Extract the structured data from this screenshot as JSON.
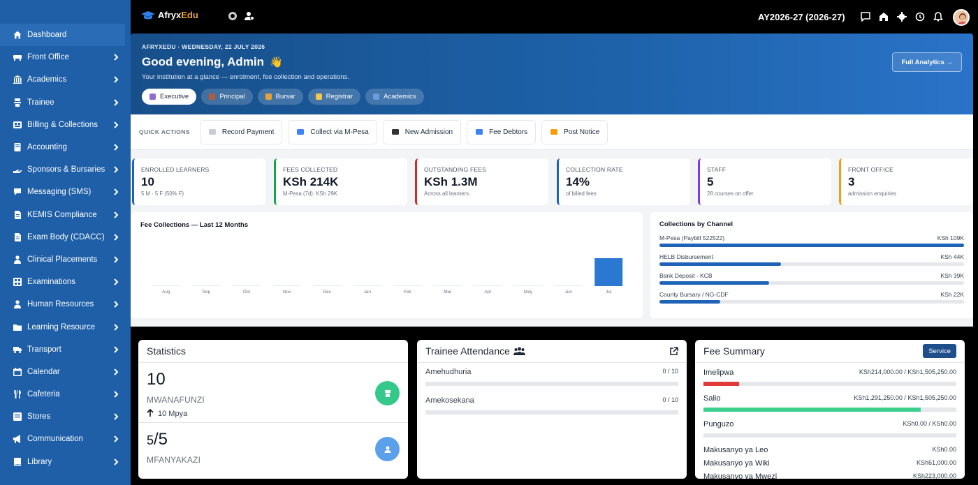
{
  "brand": {
    "name_prefix": "Afryx",
    "name_suffix": "Edu"
  },
  "topbar": {
    "academic_year": "AY2026-27 (2026-27)"
  },
  "sidebar": {
    "items": [
      {
        "label": "Dashboard",
        "icon": "home-icon",
        "active": true,
        "chevron": false
      },
      {
        "label": "Front Office",
        "icon": "desk-icon",
        "chevron": true
      },
      {
        "label": "Academics",
        "icon": "institution-icon",
        "chevron": true
      },
      {
        "label": "Trainee",
        "icon": "trainee-icon",
        "chevron": true
      },
      {
        "label": "Billing & Collections",
        "icon": "billing-icon",
        "chevron": true
      },
      {
        "label": "Accounting",
        "icon": "ledger-icon",
        "chevron": true
      },
      {
        "label": "Sponsors & Bursaries",
        "icon": "hand-icon",
        "chevron": true
      },
      {
        "label": "Messaging (SMS)",
        "icon": "chat-icon",
        "chevron": true
      },
      {
        "label": "KEMIS Compliance",
        "icon": "doc-icon",
        "chevron": true
      },
      {
        "label": "Exam Body (CDACC)",
        "icon": "doc-icon",
        "chevron": true
      },
      {
        "label": "Clinical Placements",
        "icon": "person-icon",
        "chevron": true
      },
      {
        "label": "Examinations",
        "icon": "grid-icon",
        "chevron": true
      },
      {
        "label": "Human Resources",
        "icon": "person-icon",
        "chevron": true
      },
      {
        "label": "Learning Resource",
        "icon": "folder-icon",
        "chevron": true
      },
      {
        "label": "Transport",
        "icon": "truck-icon",
        "chevron": true
      },
      {
        "label": "Calendar",
        "icon": "calendar-icon",
        "chevron": true
      },
      {
        "label": "Cafeteria",
        "icon": "cutlery-icon",
        "chevron": true
      },
      {
        "label": "Stores",
        "icon": "box-icon",
        "chevron": true
      },
      {
        "label": "Communication",
        "icon": "megaphone-icon",
        "chevron": true
      },
      {
        "label": "Library",
        "icon": "book-icon",
        "chevron": true
      }
    ]
  },
  "hero": {
    "kicker": "AFRYXEDU · WEDNESDAY, 22 JULY 2026",
    "title": "Good evening, Admin",
    "wave": "👋",
    "subtitle": "Your institution at a glance — enrolment, fee collection and operations.",
    "analytics_button": "Full Analytics →",
    "tabs": [
      {
        "label": "Executive",
        "color": "#8a6fd1"
      },
      {
        "label": "Principal",
        "color": "#b45a3c"
      },
      {
        "label": "Bursar",
        "color": "#e8a23a"
      },
      {
        "label": "Registrar",
        "color": "#f2c94c"
      },
      {
        "label": "Academics",
        "color": "#6b9bd8"
      }
    ]
  },
  "quick_actions": {
    "label": "QUICK ACTIONS",
    "buttons": [
      {
        "label": "Record Payment",
        "icon": "receipt-icon",
        "color": "#c9ccd6"
      },
      {
        "label": "Collect via M-Pesa",
        "icon": "card-icon",
        "color": "#3b82f6"
      },
      {
        "label": "New Admission",
        "icon": "graduation-cap-icon",
        "color": "#333"
      },
      {
        "label": "Fee Debtors",
        "icon": "chart-icon",
        "color": "#3b82f6"
      },
      {
        "label": "Post Notice",
        "icon": "megaphone-icon",
        "color": "#f59e0b"
      }
    ]
  },
  "kpis": [
    {
      "label": "ENROLLED LEARNERS",
      "value": "10",
      "sub": "5 M · 5 F (50% F)",
      "color": "#1e63b8"
    },
    {
      "label": "FEES COLLECTED",
      "value": "KSh 214K",
      "sub": "M-Pesa (7d): KSh 29K",
      "color": "#16a34a"
    },
    {
      "label": "OUTSTANDING FEES",
      "value": "KSh 1.3M",
      "sub": "Across all learners",
      "color": "#dc2626"
    },
    {
      "label": "COLLECTION RATE",
      "value": "14%",
      "sub": "of billed fees",
      "color": "#1e63b8"
    },
    {
      "label": "STAFF",
      "value": "5",
      "sub": "28 courses on offer",
      "color": "#7c3aed"
    },
    {
      "label": "FRONT OFFICE",
      "value": "3",
      "sub": "admission enquiries",
      "color": "#f59e0b"
    }
  ],
  "fee_chart": {
    "title": "Fee Collections — Last 12 Months"
  },
  "chart_data": {
    "type": "bar",
    "categories": [
      "Aug",
      "Sep",
      "Oct",
      "Nov",
      "Dec",
      "Jan",
      "Feb",
      "Mar",
      "Apr",
      "May",
      "Jun",
      "Jul"
    ],
    "values": [
      0,
      0,
      0,
      0,
      0,
      0,
      0,
      0,
      0,
      0,
      0,
      214
    ],
    "title": "Fee Collections — Last 12 Months",
    "xlabel": "",
    "ylabel": "",
    "ylim": [
      0,
      214
    ],
    "bar_color": "#2a78d2",
    "grid": false
  },
  "channels": {
    "title": "Collections by Channel",
    "items": [
      {
        "label": "M-Pesa (Paybill 522522)",
        "value_text": "KSh 109K",
        "fraction": 1.0
      },
      {
        "label": "HELB Disbursement",
        "value_text": "KSh 44K",
        "fraction": 0.4
      },
      {
        "label": "Bank Deposit - KCB",
        "value_text": "KSh 39K",
        "fraction": 0.36
      },
      {
        "label": "County Bursary / NG-CDF",
        "value_text": "KSh 22K",
        "fraction": 0.2
      }
    ]
  },
  "statistics": {
    "title": "Statistics",
    "blocks": [
      {
        "number": "10",
        "label": "MWANAFUNZI",
        "new": "10 Mpya",
        "icon": "graduate-icon",
        "color": "#34c98a"
      },
      {
        "number_small": "5",
        "number_big": "/5",
        "label": "MFANYAKAZI",
        "icon": "user-icon",
        "color": "#5aa0ea"
      }
    ]
  },
  "attendance": {
    "title": "Trainee Attendance",
    "rows": [
      {
        "label": "Amehudhuria",
        "value": "0 / 10",
        "fraction": 0
      },
      {
        "label": "Amekosekana",
        "value": "0 / 10",
        "fraction": 0
      }
    ]
  },
  "fee_summary": {
    "title": "Fee Summary",
    "service_button": "Service",
    "bars": [
      {
        "label": "Imelipwa",
        "value": "KSh214,000.00 / KSh1,505,250.00",
        "fraction": 0.142,
        "color": "#e23b3b"
      },
      {
        "label": "Salio",
        "value": "KSh1,291,250.00 / KSh1,505,250.00",
        "fraction": 0.858,
        "color": "#3ccf8e"
      },
      {
        "label": "Punguzo",
        "value": "KSh0.00 / KSh0.00",
        "fraction": 0,
        "color": "#3ccf8e"
      }
    ],
    "totals": [
      {
        "label": "Makusanyo ya Leo",
        "value": "KSh0.00"
      },
      {
        "label": "Makusanyo ya Wiki",
        "value": "KSh61,000.00"
      },
      {
        "label": "Makusanyo ya Mwezi",
        "value": "KSh223,000.00"
      }
    ]
  }
}
